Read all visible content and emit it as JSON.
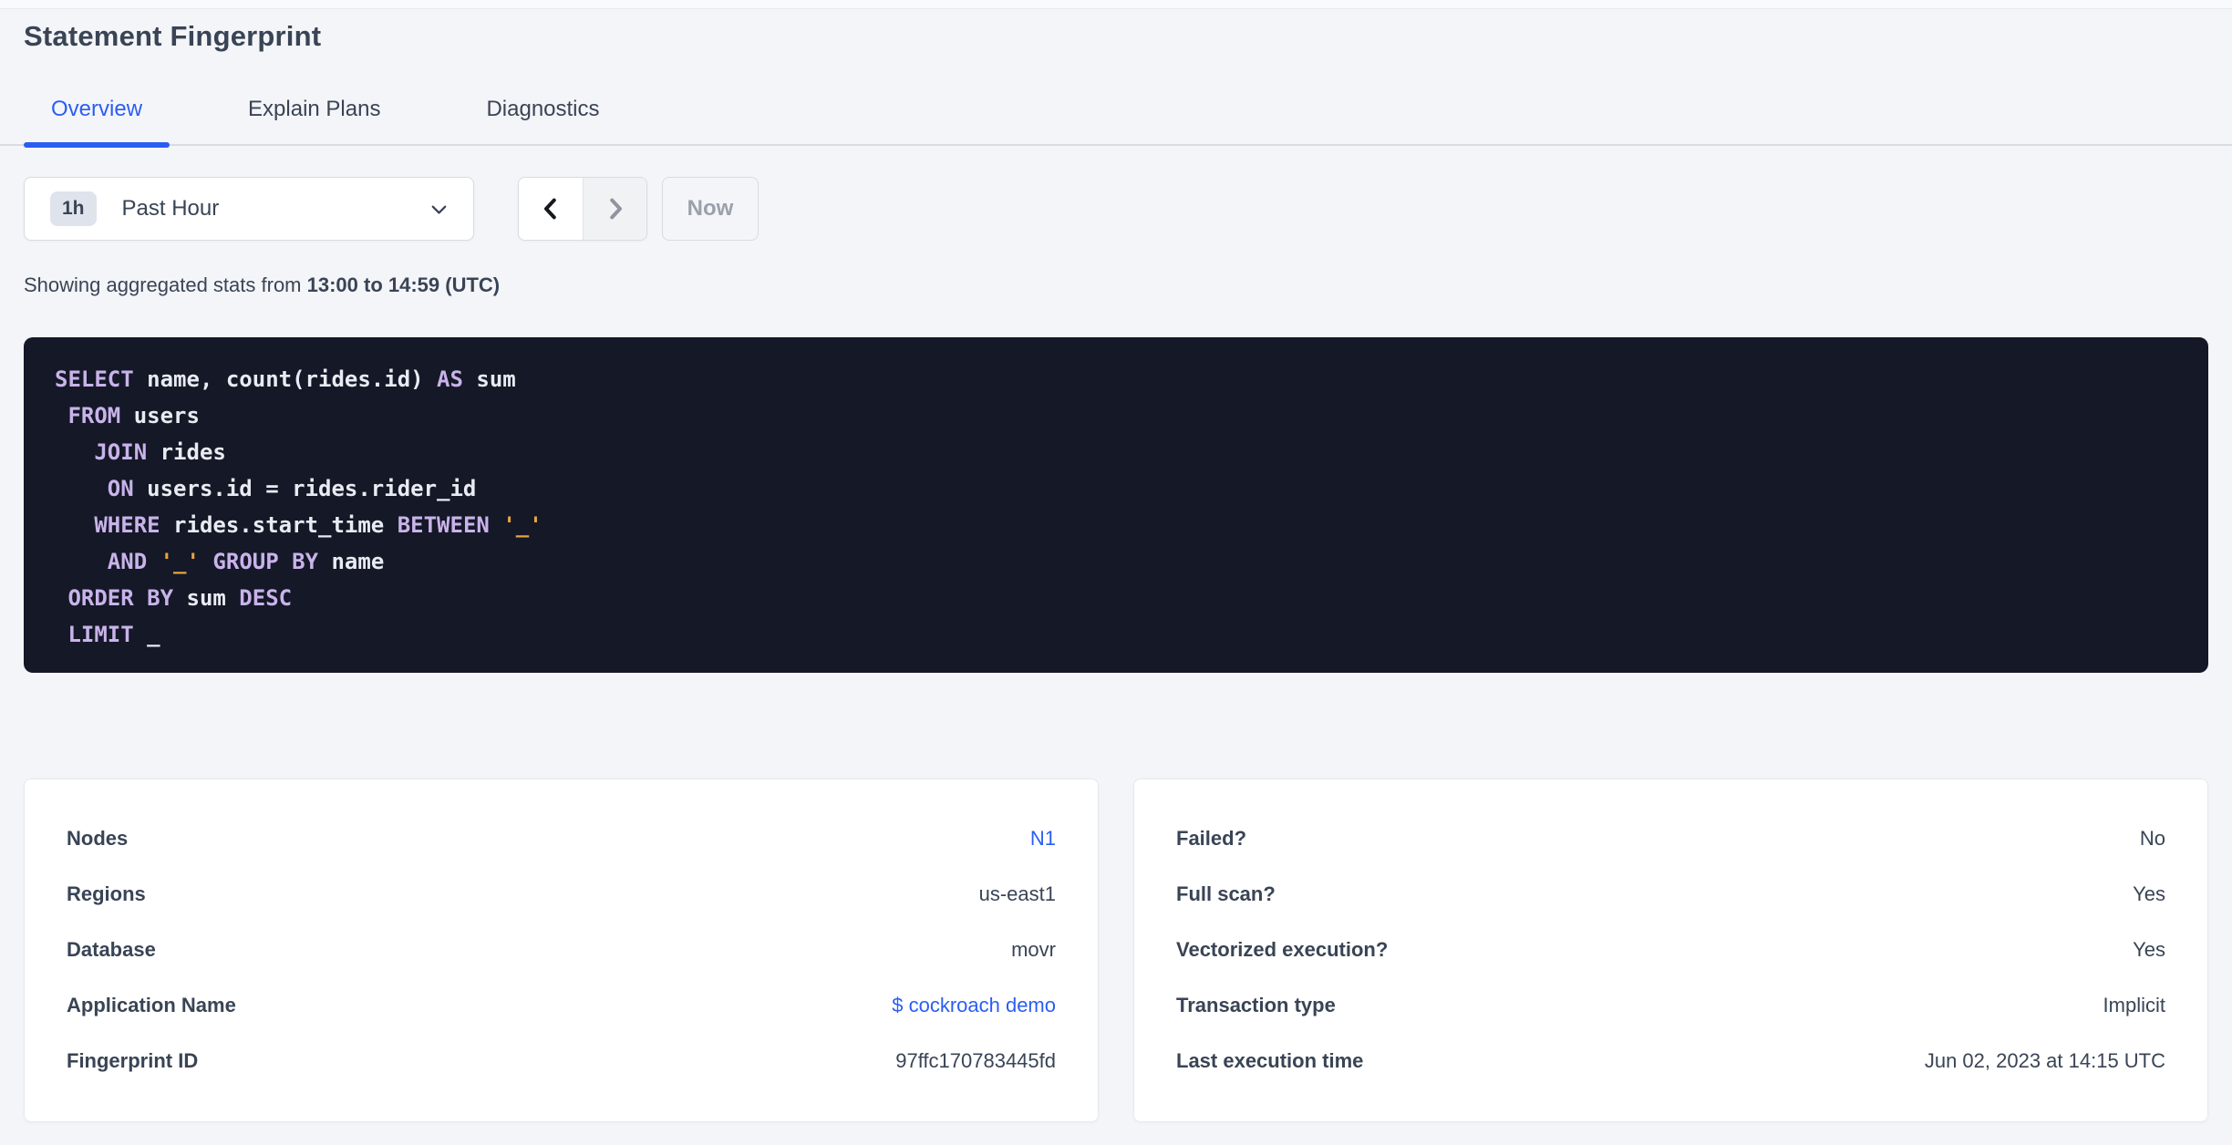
{
  "page": {
    "title": "Statement Fingerprint"
  },
  "theme": {
    "page-bg": "#f4f5f9",
    "text-dark": "#394455",
    "accent": "#2b5df2",
    "sql-bg": "#141827",
    "sql-text": "#e9ebf2",
    "sql-keyword": "#c9b3ea",
    "sql-string": "#e8a440",
    "disabled-text": "#9aa0ac"
  },
  "tabs": [
    {
      "label": "Overview",
      "active": true
    },
    {
      "label": "Explain Plans",
      "active": false
    },
    {
      "label": "Diagnostics",
      "active": false
    }
  ],
  "toolbar": {
    "interval_badge": "1h",
    "interval_label": "Past Hour",
    "now_label": "Now",
    "prev_enabled": true,
    "next_enabled": false
  },
  "stats": {
    "prefix": "Showing aggregated stats from ",
    "range": "13:00 to 14:59 (UTC)"
  },
  "sql": {
    "lines": [
      [
        {
          "t": "SELECT",
          "k": "kw"
        },
        {
          "t": " name, count(rides.id) ",
          "k": "id"
        },
        {
          "t": "AS",
          "k": "kw"
        },
        {
          "t": " sum",
          "k": "id"
        }
      ],
      [
        {
          "t": " ",
          "k": "id"
        },
        {
          "t": "FROM",
          "k": "kw"
        },
        {
          "t": " users",
          "k": "id"
        }
      ],
      [
        {
          "t": "   ",
          "k": "id"
        },
        {
          "t": "JOIN",
          "k": "kw"
        },
        {
          "t": " rides",
          "k": "id"
        }
      ],
      [
        {
          "t": "    ",
          "k": "id"
        },
        {
          "t": "ON",
          "k": "kw"
        },
        {
          "t": " users.id = rides.rider_id",
          "k": "id"
        }
      ],
      [
        {
          "t": "   ",
          "k": "id"
        },
        {
          "t": "WHERE",
          "k": "kw"
        },
        {
          "t": " rides.start_time ",
          "k": "id"
        },
        {
          "t": "BETWEEN",
          "k": "kw"
        },
        {
          "t": " ",
          "k": "id"
        },
        {
          "t": "'_'",
          "k": "str"
        }
      ],
      [
        {
          "t": "    ",
          "k": "id"
        },
        {
          "t": "AND",
          "k": "kw"
        },
        {
          "t": " ",
          "k": "id"
        },
        {
          "t": "'_'",
          "k": "str"
        },
        {
          "t": " ",
          "k": "id"
        },
        {
          "t": "GROUP BY",
          "k": "kw"
        },
        {
          "t": " name",
          "k": "id"
        }
      ],
      [
        {
          "t": " ",
          "k": "id"
        },
        {
          "t": "ORDER BY",
          "k": "kw"
        },
        {
          "t": " sum ",
          "k": "id"
        },
        {
          "t": "DESC",
          "k": "kw"
        }
      ],
      [
        {
          "t": " ",
          "k": "id"
        },
        {
          "t": "LIMIT",
          "k": "kw"
        },
        {
          "t": " _",
          "k": "id"
        }
      ]
    ]
  },
  "cards": [
    {
      "name": "statement-details-card",
      "rows": [
        {
          "label": "Nodes",
          "value": "N1",
          "link": true
        },
        {
          "label": "Regions",
          "value": "us-east1",
          "link": false
        },
        {
          "label": "Database",
          "value": "movr",
          "link": false
        },
        {
          "label": "Application Name",
          "value": "$ cockroach demo",
          "link": true
        },
        {
          "label": "Fingerprint ID",
          "value": "97ffc170783445fd",
          "link": false
        }
      ]
    },
    {
      "name": "execution-attributes-card",
      "rows": [
        {
          "label": "Failed?",
          "value": "No",
          "link": false
        },
        {
          "label": "Full scan?",
          "value": "Yes",
          "link": false
        },
        {
          "label": "Vectorized execution?",
          "value": "Yes",
          "link": false
        },
        {
          "label": "Transaction type",
          "value": "Implicit",
          "link": false
        },
        {
          "label": "Last execution time",
          "value": "Jun 02, 2023 at 14:15 UTC",
          "link": false
        }
      ]
    }
  ]
}
